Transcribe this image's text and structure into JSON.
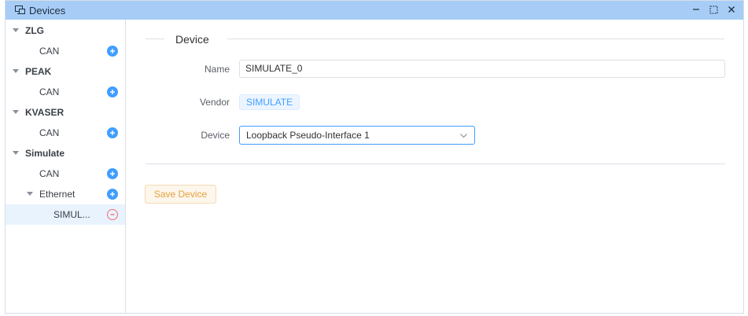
{
  "window": {
    "title": "Devices",
    "controls": [
      "minimize",
      "maximize",
      "close"
    ]
  },
  "sidebar": {
    "groups": [
      {
        "label": "ZLG",
        "expanded": true,
        "children": [
          {
            "label": "CAN",
            "action": "add"
          }
        ]
      },
      {
        "label": "PEAK",
        "expanded": true,
        "children": [
          {
            "label": "CAN",
            "action": "add"
          }
        ]
      },
      {
        "label": "KVASER",
        "expanded": true,
        "children": [
          {
            "label": "CAN",
            "action": "add"
          }
        ]
      },
      {
        "label": "Simulate",
        "expanded": true,
        "children": [
          {
            "label": "CAN",
            "action": "add"
          },
          {
            "label": "Ethernet",
            "action": "add",
            "expanded": true,
            "children": [
              {
                "label": "SIMUL...",
                "action": "remove",
                "selected": true
              }
            ]
          }
        ]
      }
    ]
  },
  "form": {
    "section_title": "Device",
    "name_label": "Name",
    "name_value": "SIMULATE_0",
    "vendor_label": "Vendor",
    "vendor_value": "SIMULATE",
    "device_label": "Device",
    "device_value": "Loopback Pseudo-Interface 1",
    "save_label": "Save Device"
  },
  "colors": {
    "titlebar": "#a7cdf7",
    "accent": "#409eff",
    "remove": "#f56c6c",
    "warning": "#e6a23c",
    "selected_row": "#e9f3fe"
  },
  "icons": {
    "title": "devices-icon",
    "add": "plus-circle-icon",
    "remove": "minus-circle-icon",
    "expand": "caret-down-icon",
    "select": "chevron-down-icon"
  }
}
